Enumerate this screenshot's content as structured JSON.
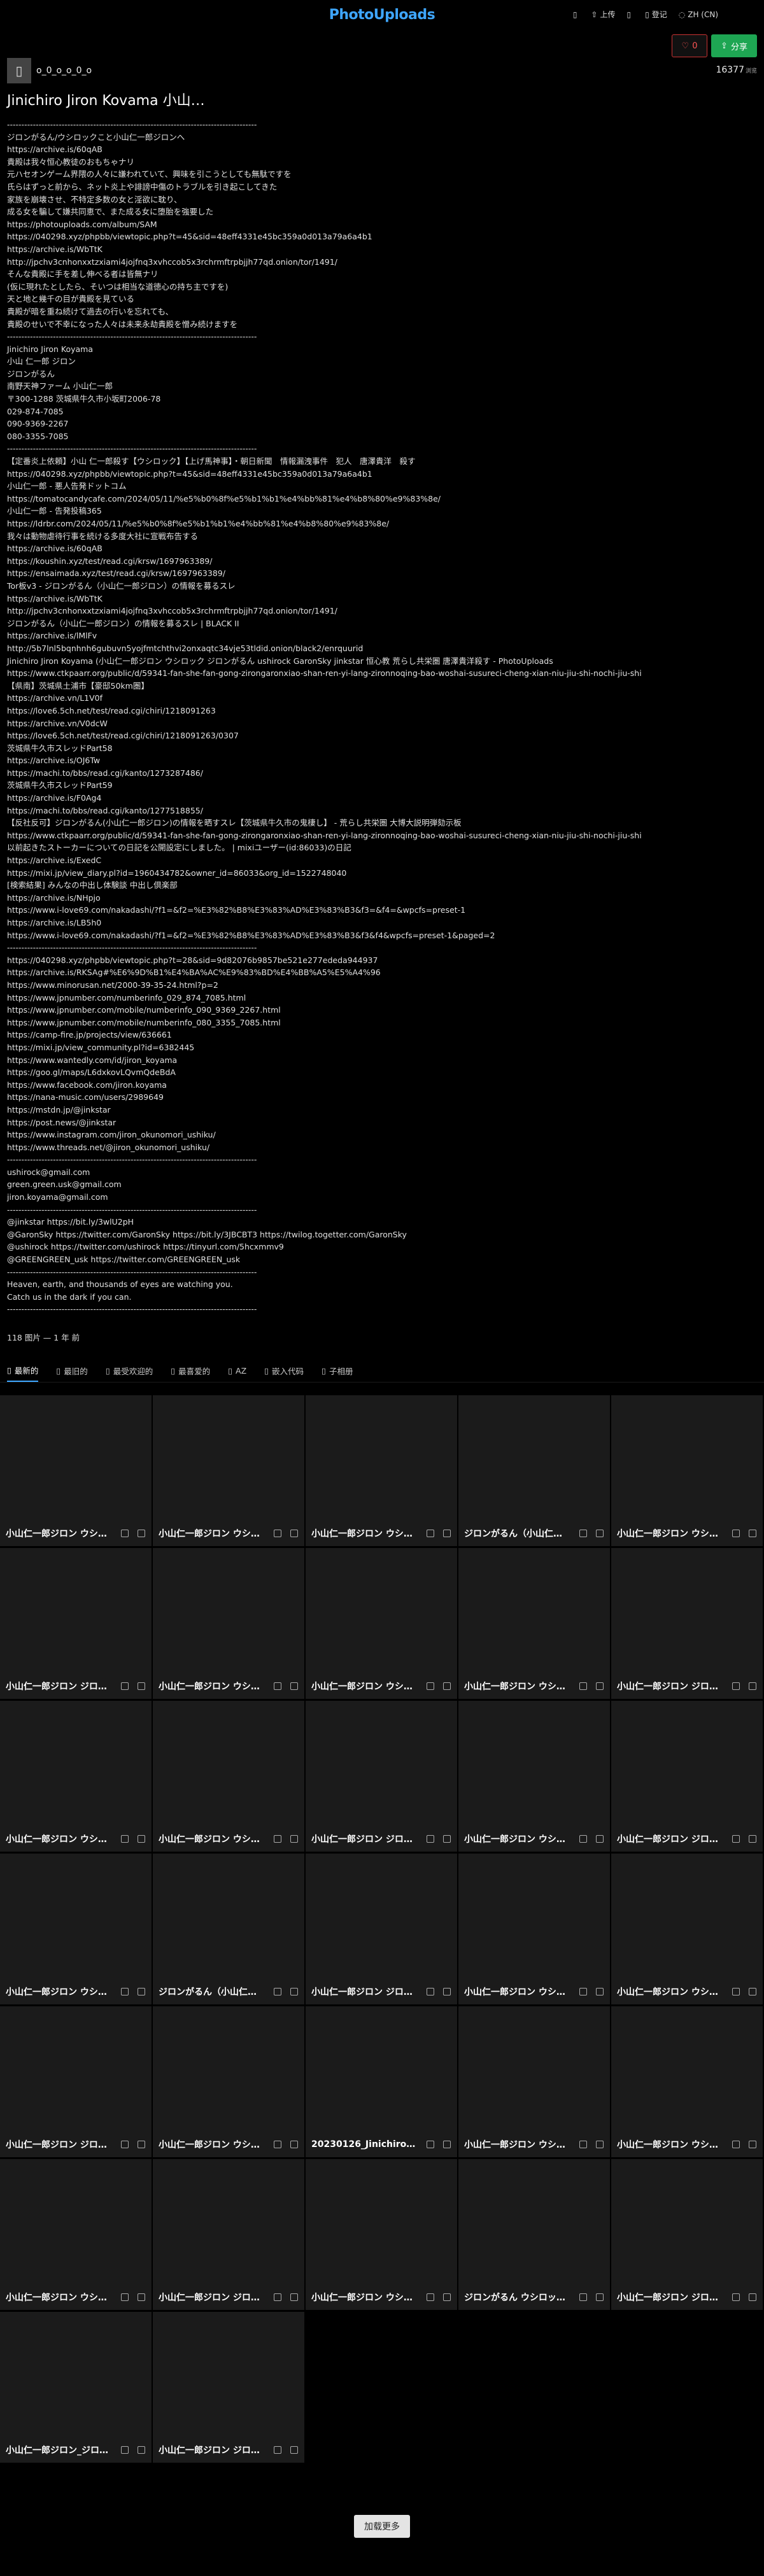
{
  "header": {
    "logo": "PhotoUploads",
    "nav": [
      {
        "icon": "menu-icon",
        "label": ""
      },
      {
        "icon": "upload-icon",
        "label": "上传"
      },
      {
        "icon": "folder-icon",
        "label": ""
      },
      {
        "icon": "user-icon",
        "label": "登记"
      },
      {
        "icon": "language-icon",
        "label": "ZH (CN)"
      }
    ]
  },
  "actions": {
    "like_count": "0",
    "share_label": "分享"
  },
  "profile": {
    "username": "o_0_o_o_0_o",
    "views": "16377",
    "views_unit": "浏览",
    "title": "Jinichiro Jiron Kovama 小山…",
    "meta": "118 图片 — 1 年 前"
  },
  "description": "---------------------------------------------------------------------------------------\nジロンがるん/ウシロックこと小山仁一郎ジロンへ\nhttps://archive.is/60qAB\n貴殿は我々恒心教徒のおもちゃナリ\n元ハセオンゲーム界隈の人々に嫌われていて、興味を引こうとしても無駄ですを\n氏らはずっと前から、ネット炎上や誹謗中傷のトラブルを引き起こしてきた\n家族を崩壊させ、不特定多数の女と淫欲に耽り、\n成る女を騙して嫌共同恵で、また成る女に堕胎を強要した\nhttps://photouploads.com/album/SAM\nhttps://040298.xyz/phpbb/viewtopic.php?t=45&sid=48eff4331e45bc359a0d013a79a6a4b1\nhttps://archive.is/WbTtK\nhttp://jpchv3cnhonxxtzxiami4jojfnq3xvhccob5x3rchrmftrpbjjh77qd.onion/tor/1491/\nそんな貴殿に手を差し伸べる者は皆無ナリ\n(仮に現れたとしたら、そいつは相当な道徳心の持ち主ですを)\n天と地と幾千の目が貴殿を見ている\n貴殿が暗を重ね続けて過去の行いを忘れても、\n貴殿のせいで不幸になった人々は未来永劫貴殿を憎み続けますを\n---------------------------------------------------------------------------------------\nJinichiro Jiron Koyama\n小山 仁一郎 ジロン\nジロンがるん\n南野天神ファーム 小山仁一郎\n〒300-1288 茨城県牛久市小坂町2006-78\n029-874-7085\n090-9369-2267\n080-3355-7085\n---------------------------------------------------------------------------------------\n【定番炎上依頼】小山 仁一郎殺す【ウシロック】【上げ馬神事】・朝日新聞　情報漏洩事件　犯人　唐澤貴洋　殺す\nhttps://040298.xyz/phpbb/viewtopic.php?t=45&sid=48eff4331e45bc359a0d013a79a6a4b1\n小山仁一郎 - 悪人告発ドットコム\nhttps://tomatocandycafe.com/2024/05/11/%e5%b0%8f%e5%b1%b1%e4%bb%81%e4%b8%80%e9%83%8e/\n小山仁一郎 - 告発投稿365\nhttps://ldrbr.com/2024/05/11/%e5%b0%8f%e5%b1%b1%e4%bb%81%e4%b8%80%e9%83%8e/\n我々は動物虐待行事を続ける多度大社に宣戦布告する\nhttps://archive.is/60qAB\nhttps://koushin.xyz/test/read.cgi/krsw/1697963389/\nhttps://ensaimada.xyz/test/read.cgi/krsw/1697963389/\nTor板v3 - ジロンがるん（小山仁一郎ジロン）の情報を募るスレ\nhttps://archive.is/WbTtK\nhttp://jpchv3cnhonxxtzxiami4jojfnq3xvhccob5x3rchrmftrpbjjh77qd.onion/tor/1491/\nジロンがるん（小山仁一郎ジロン）の情報を募るスレ | BLACK II\nhttps://archive.is/lMlFv\nhttp://5b7lnl5bqnhnh6gubuvn5yojfmtchthvi2onxaqtc34vje53tldid.onion/black2/enrquurid\nJinichiro Jiron Koyama (小山仁一郎ジロン ウシロック ジロンがるん ushirock GaronSky jinkstar 恒心教 荒らし共栄圏 唐澤貴洋殺す - PhotoUploads\nhttps://www.ctkpaarr.org/public/d/59341-fan-she-fan-gong-zirongaronxiao-shan-ren-yi-lang-zironnoqing-bao-woshai-susureci-cheng-xian-niu-jiu-shi-nochi-jiu-shi\n【県南】茨城県土浦市【豪邸50km圏】\nhttps://archive.vn/L1V0f\nhttps://love6.5ch.net/test/read.cgi/chiri/1218091263\nhttps://archive.vn/V0dcW\nhttps://love6.5ch.net/test/read.cgi/chiri/1218091263/0307\n茨城県牛久市スレッドPart58\nhttps://archive.is/OJ6Tw\nhttps://machi.to/bbs/read.cgi/kanto/1273287486/\n茨城県牛久市スレッドPart59\nhttps://archive.is/F0Ag4\nhttps://machi.to/bbs/read.cgi/kanto/1277518855/\n【反社反可】ジロンがるん(小山仁一郎ジロン)の情報を晒すスレ【茨城県牛久市の鬼棲し】 - 荒らし共栄圏 大博大説明弾劾示板\nhttps://www.ctkpaarr.org/public/d/59341-fan-she-fan-gong-zirongaronxiao-shan-ren-yi-lang-zironnoqing-bao-woshai-susureci-cheng-xian-niu-jiu-shi-nochi-jiu-shi\n以前起きたストーカーについての日記を公開設定にしました。 | mixiユーザー(id:86033)の日記\nhttps://archive.is/ExedC\nhttps://mixi.jp/view_diary.pl?id=1960434782&owner_id=86033&org_id=1522748040\n[検索結果] みんなの中出し体験談 中出し倶楽部\nhttps://archive.is/NHpjo\nhttps://www.i-love69.com/nakadashi/?f1=&f2=%E3%82%B8%E3%83%AD%E3%83%B3&f3=&f4=&wpcfs=preset-1\nhttps://archive.is/LB5h0\nhttps://www.i-love69.com/nakadashi/?f1=&f2=%E3%82%B8%E3%83%AD%E3%83%B3&f3&f4&wpcfs=preset-1&paged=2\n---------------------------------------------------------------------------------------\nhttps://040298.xyz/phpbb/viewtopic.php?t=28&sid=9d82076b9857be521e277ededa944937\nhttps://archive.is/RKSAg#%E6%9D%B1%E4%BA%AC%E9%83%BD%E4%BB%A5%E5%A4%96\nhttps://www.minorusan.net/2000-39-35-24.html?p=2\nhttps://www.jpnumber.com/numberinfo_029_874_7085.html\nhttps://www.jpnumber.com/mobile/numberinfo_090_9369_2267.html\nhttps://www.jpnumber.com/mobile/numberinfo_080_3355_7085.html\nhttps://camp-fire.jp/projects/view/636661\nhttps://mixi.jp/view_community.pl?id=6382445\nhttps://www.wantedly.com/id/jiron_koyama\nhttps://goo.gl/maps/L6dxkovLQvmQdeBdA\nhttps://www.facebook.com/jiron.koyama\nhttps://nana-music.com/users/2989649\nhttps://mstdn.jp/@jinkstar\nhttps://post.news/@jinkstar\nhttps://www.instagram.com/jiron_okunomori_ushiku/\nhttps://www.threads.net/@jiron_okunomori_ushiku/\n---------------------------------------------------------------------------------------\nushirock@gmail.com\ngreen.green.usk@gmail.com\njiron.koyama@gmail.com\n---------------------------------------------------------------------------------------\n@jinkstar https://bit.ly/3wlU2pH\n@GaronSky https://twitter.com/GaronSky https://bit.ly/3JBCBT3 https://twilog.togetter.com/GaronSky\n@ushirock https://twitter.com/ushirock https://tinyurl.com/5hcxmmv9\n@GREENGREEN_usk https://twitter.com/GREENGREEN_usk\n---------------------------------------------------------------------------------------\nHeaven, earth, and thousands of eyes are watching you.\nCatch us in the dark if you can.\n---------------------------------------------------------------------------------------",
  "tabs": [
    {
      "icon": "clock-icon",
      "label": "最新的"
    },
    {
      "icon": "calendar-icon",
      "label": "最旧的"
    },
    {
      "icon": "star-icon",
      "label": "最受欢迎的"
    },
    {
      "icon": "heart-icon",
      "label": "最喜爱的"
    },
    {
      "icon": "sort-icon",
      "label": "AZ"
    },
    {
      "icon": "embed-icon",
      "label": "嵌入代码"
    },
    {
      "icon": "list-icon",
      "label": "子相册"
    }
  ],
  "grid": [
    "小山仁一郎ジロン ウシ…",
    "小山仁一郎ジロン ウシ…",
    "小山仁一郎ジロン ウシ…",
    "ジロンがるん（小山仁…",
    "小山仁一郎ジロン ウシ…",
    "小山仁一郎ジロン ジロ…",
    "小山仁一郎ジロン ウシ…",
    "小山仁一郎ジロン ウシ…",
    "小山仁一郎ジロン ウシ…",
    "小山仁一郎ジロン ジロ…",
    "小山仁一郎ジロン ウシ…",
    "小山仁一郎ジロン ウシ…",
    "小山仁一郎ジロン ジロ…",
    "小山仁一郎ジロン ウシ…",
    "小山仁一郎ジロン ジロ…",
    "小山仁一郎ジロン ウシ…",
    "ジロンがるん（小山仁…",
    "小山仁一郎ジロン ジロ…",
    "小山仁一郎ジロン ウシ…",
    "小山仁一郎ジロン ウシ…",
    "小山仁一郎ジロン ジロ…",
    "小山仁一郎ジロン ウシ…",
    "20230126_Jinichiro_J…",
    "小山仁一郎ジロン ウシ…",
    "小山仁一郎ジロン ウシ…",
    "小山仁一郎ジロン ウシ…",
    "小山仁一郎ジロン ジロ…",
    "小山仁一郎ジロン ウシ…",
    "ジロンがるん ウシロッ…",
    "小山仁一郎ジロン ジロ…",
    "小山仁一郎ジロン_ジロ…",
    "小山仁一郎ジロン ジロ…"
  ],
  "load_more": "加载更多"
}
